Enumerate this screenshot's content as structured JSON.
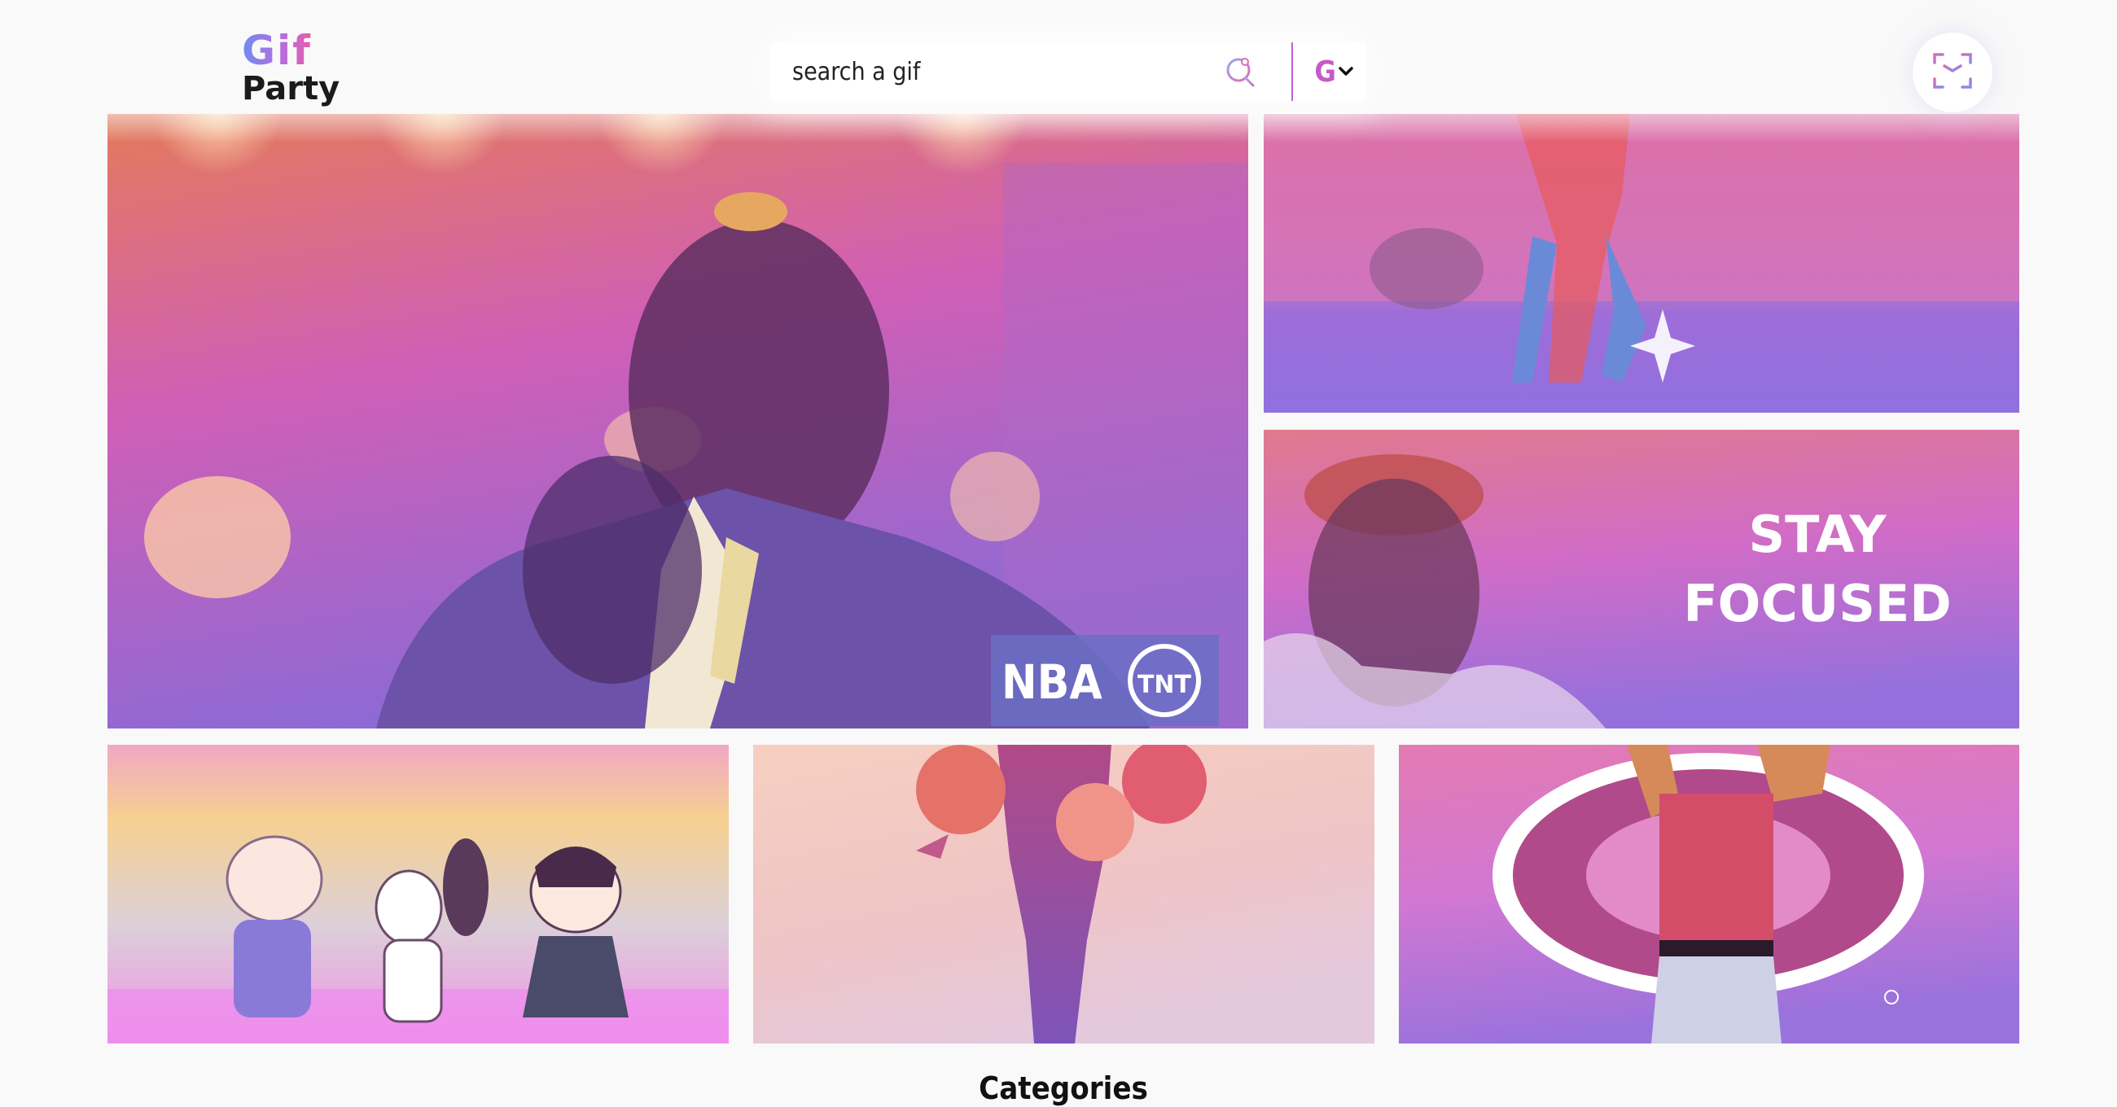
{
  "header": {
    "logo": {
      "line1": "Gif",
      "line2": "Party"
    },
    "search": {
      "placeholder": "search a gif",
      "icon": "search-icon"
    },
    "rating": {
      "selected": "G",
      "icon": "chevron-down-icon"
    },
    "favorites": {
      "icon": "sparkle-frame-icon"
    }
  },
  "gifs": [
    {
      "id": "shaq-nba",
      "badge": "NBA",
      "network": "TNT"
    },
    {
      "id": "stage-dancer"
    },
    {
      "id": "stay-focused",
      "caption_line1": "STAY",
      "caption_line2": "FOCUSED"
    },
    {
      "id": "peanuts-dance"
    },
    {
      "id": "balloons"
    },
    {
      "id": "georgia-mascot"
    }
  ],
  "sections": {
    "categories_title": "Categories"
  },
  "colors": {
    "accent": "#c75ce0",
    "gradient_top": "#e88a6a",
    "gradient_mid": "#d060c0",
    "gradient_bottom": "#8d6ad8",
    "page_bg": "#f9f9f9"
  }
}
